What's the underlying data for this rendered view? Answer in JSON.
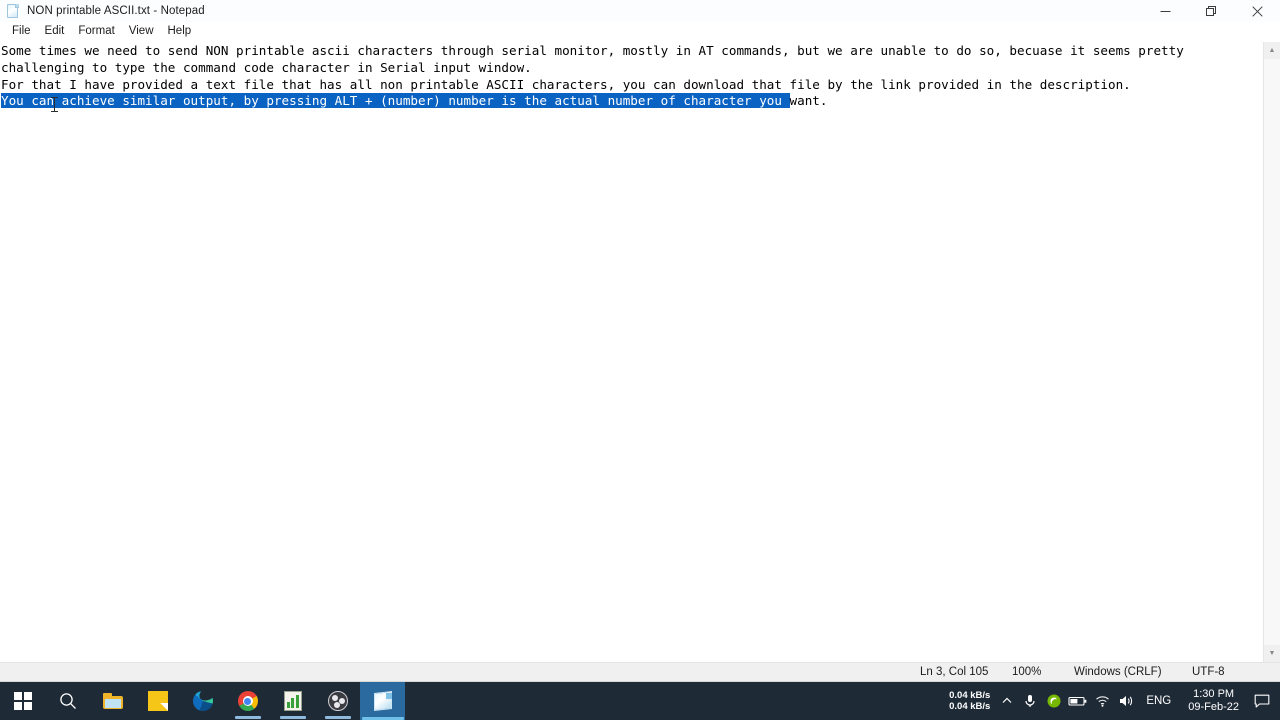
{
  "window": {
    "title": "NON printable ASCII.txt - Notepad",
    "icon": "notepad-document-icon",
    "controls": {
      "minimize_label": "Minimize",
      "restore_label": "Restore Down",
      "close_label": "Close"
    }
  },
  "menu": {
    "items": [
      {
        "label": "File"
      },
      {
        "label": "Edit"
      },
      {
        "label": "Format"
      },
      {
        "label": "View"
      },
      {
        "label": "Help"
      }
    ]
  },
  "editor": {
    "lines": [
      {
        "segments": [
          {
            "text": "Some times we need to send NON printable ascii characters through serial monitor, mostly in AT commands, but we are unable to do so, becuase it seems pretty",
            "selected": false
          }
        ]
      },
      {
        "segments": [
          {
            "text": "challenging to type the command code character in Serial input window.",
            "selected": false
          }
        ]
      },
      {
        "segments": [
          {
            "text": "For that I have provided a text file that has all non printable ASCII characters, you can download that file by the link provided in the description.",
            "selected": false
          }
        ]
      },
      {
        "segments": [
          {
            "text": "You can achieve similar output, by pressing ALT + (number) number is the actual number of character you ",
            "selected": true
          },
          {
            "text": "want.",
            "selected": false
          }
        ]
      }
    ],
    "selection_color": "#0a62c2",
    "selection_text_color": "#ffffff",
    "mouse_cursor": "text-ibeam-cursor"
  },
  "scrollbar": {
    "up_arrow": "▲",
    "down_arrow": "▼"
  },
  "status_bar": {
    "position": "Ln 3, Col 105",
    "zoom": "100%",
    "line_ending": "Windows (CRLF)",
    "encoding": "UTF-8"
  },
  "taskbar": {
    "buttons": [
      {
        "name": "start-button",
        "icon": "windows-logo-icon",
        "running": false,
        "active": false
      },
      {
        "name": "search-button",
        "icon": "search-icon",
        "running": false,
        "active": false
      },
      {
        "name": "file-explorer-button",
        "icon": "folder-icon",
        "running": false,
        "active": false
      },
      {
        "name": "sticky-notes-button",
        "icon": "sticky-note-icon",
        "running": false,
        "active": false
      },
      {
        "name": "edge-button",
        "icon": "edge-browser-icon",
        "running": false,
        "active": false
      },
      {
        "name": "chrome-button",
        "icon": "chrome-browser-icon",
        "running": true,
        "active": false
      },
      {
        "name": "chart-app-button",
        "icon": "chart-document-icon",
        "running": true,
        "active": false
      },
      {
        "name": "obs-button",
        "icon": "obs-studio-icon",
        "running": true,
        "active": false
      },
      {
        "name": "notepad-button",
        "icon": "notepad-document-icon",
        "running": true,
        "active": true
      }
    ],
    "tray": {
      "net_down": "0.04 kB/s",
      "net_up": "0.04 kB/s",
      "chevron": "⌃",
      "icons": [
        {
          "name": "microphone-icon"
        },
        {
          "name": "nvidia-icon"
        },
        {
          "name": "battery-icon"
        },
        {
          "name": "wifi-icon"
        },
        {
          "name": "volume-icon"
        }
      ],
      "language": "ENG",
      "time": "1:30 PM",
      "date": "09-Feb-22",
      "action_center": "notification-icon"
    }
  },
  "colors": {
    "taskbar_bg": "#1f2a37",
    "active_task_bg": "#2a6a9e",
    "status_bg": "#f0f0f0",
    "selection": "#0a62c2"
  }
}
